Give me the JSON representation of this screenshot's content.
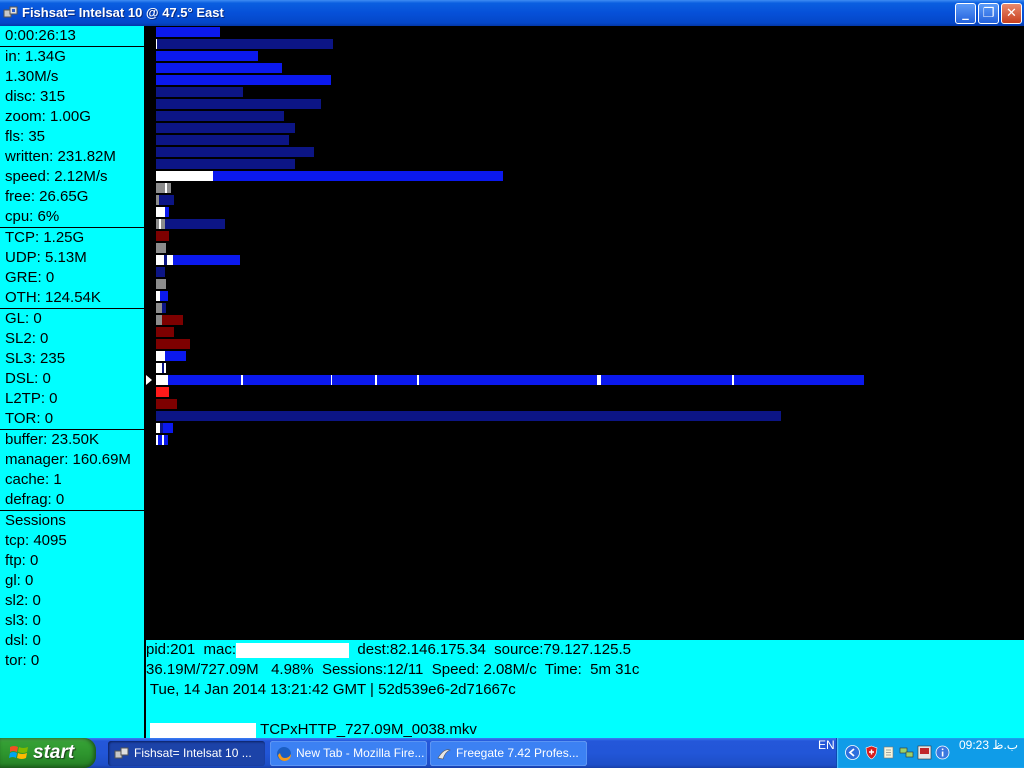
{
  "window": {
    "title": "Fishsat= Intelsat 10 @ 47.5° East",
    "minimize": "_",
    "maximize": "❐",
    "close": "✕"
  },
  "stats": {
    "time": [
      "0:00:26:13"
    ],
    "traffic": [
      "in: 1.34G",
      "1.30M/s",
      "disc: 315",
      "zoom: 1.00G",
      "fls: 35",
      "written: 231.82M",
      "speed: 2.12M/s",
      "free: 26.65G",
      "cpu: 6%"
    ],
    "protocols": [
      "TCP: 1.25G",
      "UDP: 5.13M",
      "GRE: 0",
      "OTH: 124.54K"
    ],
    "encaps": [
      "GL: 0",
      "SL2: 0",
      "SL3: 235",
      "DSL: 0",
      "L2TP: 0",
      "TOR: 0"
    ],
    "buffers": [
      "buffer: 23.50K",
      "manager: 160.69M",
      "cache: 1",
      "defrag: 0"
    ],
    "sessions": [
      "Sessions",
      "tcp: 4095",
      "ftp: 0",
      "gl: 0",
      "sl2: 0",
      "sl3: 0",
      "dsl: 0",
      "tor: 0"
    ]
  },
  "colors": {
    "panel": "#00ffff",
    "background": "#000000",
    "blue": "#0b19ee",
    "navy": "#0c1585",
    "white": "#ffffff",
    "gray": "#8c8c8c",
    "darkred": "#7d0000",
    "red": "#ff1a1a"
  },
  "chart_data": {
    "type": "bar",
    "note_units": "relative bar length 0-1 of full scale",
    "rows": [
      {
        "segments": [
          {
            "c": "blue",
            "v": 0.09
          }
        ]
      },
      {
        "segments": [
          {
            "c": "white",
            "v": 0.002
          },
          {
            "c": "navy",
            "v": 0.248
          }
        ]
      },
      {
        "segments": [
          {
            "c": "blue",
            "v": 0.143
          }
        ]
      },
      {
        "segments": [
          {
            "c": "blue",
            "v": 0.178
          }
        ]
      },
      {
        "segments": [
          {
            "c": "blue",
            "v": 0.246
          }
        ]
      },
      {
        "segments": [
          {
            "c": "navy",
            "v": 0.123
          }
        ]
      },
      {
        "segments": [
          {
            "c": "navy",
            "v": 0.232
          }
        ]
      },
      {
        "segments": [
          {
            "c": "navy",
            "v": 0.18
          }
        ]
      },
      {
        "segments": [
          {
            "c": "navy",
            "v": 0.196
          }
        ]
      },
      {
        "segments": [
          {
            "c": "navy",
            "v": 0.188
          }
        ]
      },
      {
        "segments": [
          {
            "c": "navy",
            "v": 0.223
          }
        ]
      },
      {
        "segments": [
          {
            "c": "navy",
            "v": 0.196
          }
        ]
      },
      {
        "segments": [
          {
            "c": "white",
            "v": 0.08
          },
          {
            "c": "blue",
            "v": 0.409
          }
        ]
      },
      {
        "segments": [
          {
            "c": "gray",
            "v": 0.012
          },
          {
            "c": "white",
            "v": 0.003
          },
          {
            "c": "gray",
            "v": 0.006
          }
        ]
      },
      {
        "segments": [
          {
            "c": "gray",
            "v": 0.004
          },
          {
            "c": "navy",
            "v": 0.021
          }
        ]
      },
      {
        "segments": [
          {
            "c": "white",
            "v": 0.013
          },
          {
            "c": "blue",
            "v": 0.005
          }
        ]
      },
      {
        "segments": [
          {
            "c": "gray",
            "v": 0.004
          },
          {
            "c": "white",
            "v": 0.003
          },
          {
            "c": "gray",
            "v": 0.006
          },
          {
            "c": "navy",
            "v": 0.085
          }
        ]
      },
      {
        "segments": [
          {
            "c": "darkred",
            "v": 0.018
          }
        ]
      },
      {
        "segments": [
          {
            "c": "gray",
            "v": 0.014
          }
        ]
      },
      {
        "segments": [
          {
            "c": "white",
            "v": 0.011
          },
          {
            "c": "navy",
            "v": 0.004
          },
          {
            "c": "white",
            "v": 0.008
          },
          {
            "c": "blue",
            "v": 0.095
          }
        ]
      },
      {
        "segments": [
          {
            "c": "navy",
            "v": 0.013
          }
        ]
      },
      {
        "segments": [
          {
            "c": "gray",
            "v": 0.014
          }
        ]
      },
      {
        "segments": [
          {
            "c": "white",
            "v": 0.006
          },
          {
            "c": "blue",
            "v": 0.011
          }
        ]
      },
      {
        "segments": [
          {
            "c": "gray",
            "v": 0.008
          },
          {
            "c": "navy",
            "v": 0.005
          }
        ]
      },
      {
        "segments": [
          {
            "c": "gray",
            "v": 0.009
          },
          {
            "c": "darkred",
            "v": 0.03
          }
        ]
      },
      {
        "segments": [
          {
            "c": "darkred",
            "v": 0.026
          }
        ]
      },
      {
        "segments": [
          {
            "c": "darkred",
            "v": 0.048
          }
        ]
      },
      {
        "segments": [
          {
            "c": "white",
            "v": 0.013
          },
          {
            "c": "blue",
            "v": 0.03
          }
        ]
      },
      {
        "segments": [
          {
            "c": "white",
            "v": 0.009
          },
          {
            "c": "navy",
            "v": 0.003
          },
          {
            "c": "white",
            "v": 0.003
          }
        ]
      },
      {
        "segments": [
          {
            "c": "white",
            "v": 0.017
          },
          {
            "c": "blue",
            "v": 0.103
          },
          {
            "c": "white",
            "v": 0.003
          },
          {
            "c": "blue",
            "v": 0.124
          },
          {
            "c": "white",
            "v": 0.002
          },
          {
            "c": "blue",
            "v": 0.061
          },
          {
            "c": "white",
            "v": 0.003
          },
          {
            "c": "blue",
            "v": 0.056
          },
          {
            "c": "white",
            "v": 0.003
          },
          {
            "c": "blue",
            "v": 0.251
          },
          {
            "c": "white",
            "v": 0.006
          },
          {
            "c": "blue",
            "v": 0.185
          },
          {
            "c": "white",
            "v": 0.003
          },
          {
            "c": "blue",
            "v": 0.183
          }
        ]
      },
      {
        "segments": [
          {
            "c": "red",
            "v": 0.018
          }
        ]
      },
      {
        "segments": [
          {
            "c": "darkred",
            "v": 0.03
          }
        ]
      },
      {
        "segments": [
          {
            "c": "navy",
            "v": 0.88
          }
        ]
      },
      {
        "segments": [
          {
            "c": "white",
            "v": 0.005
          },
          {
            "c": "navy",
            "v": 0.004
          },
          {
            "c": "blue",
            "v": 0.014
          }
        ]
      },
      {
        "segments": [
          {
            "c": "white",
            "v": 0.003
          },
          {
            "c": "blue",
            "v": 0.005
          },
          {
            "c": "white",
            "v": 0.003
          },
          {
            "c": "blue",
            "v": 0.006
          }
        ]
      }
    ]
  },
  "info": {
    "line1_pre": "pid:201  mac:",
    "line1_post": "  dest:82.146.175.34  source:79.127.125.5",
    "line2": "36.19M/727.09M   4.98%  Sessions:12/11  Speed: 2.08M/c  Time:  5m 31c",
    "line3": " Tue, 14 Jan 2014 13:21:42 GMT | 52d539e6-2d71667c",
    "line4_pre": " ",
    "line4_post": " TCPxHTTP_727.09M_0038.mkv"
  },
  "taskbar": {
    "start": "start",
    "tasks": [
      "Fishsat= Intelsat 10 ...",
      "New Tab - Mozilla Fire...",
      "Freegate 7.42 Profes..."
    ],
    "lang": "EN",
    "clock": "09:23 ب.ظ"
  }
}
